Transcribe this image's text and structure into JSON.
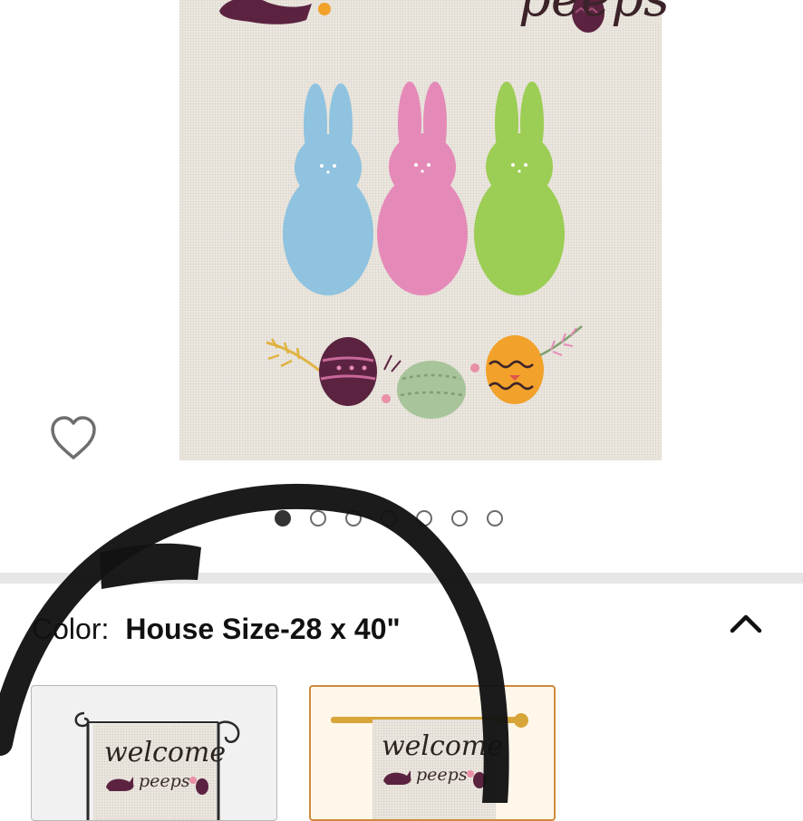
{
  "product": {
    "flag_text": "peeps",
    "image_dots": {
      "count": 7,
      "active_index": 0
    }
  },
  "color": {
    "label": "Color:",
    "value": "House Size-28 x 40\""
  },
  "swatches": [
    {
      "welcome": "welcome",
      "peeps": "peeps",
      "selected": false
    },
    {
      "welcome": "welcome",
      "peeps": "peeps",
      "selected": true
    }
  ],
  "colors": {
    "bunny_blue": "#8fc3df",
    "bunny_pink": "#e58ab8",
    "bunny_green": "#9ccd54",
    "egg_plum": "#5b2340",
    "egg_orange": "#f2a12a",
    "selected_border": "#d08a3c",
    "marker_stroke": "#121212"
  },
  "icons": {
    "favorite": "heart-outline-icon",
    "collapse": "chevron-up-icon"
  }
}
